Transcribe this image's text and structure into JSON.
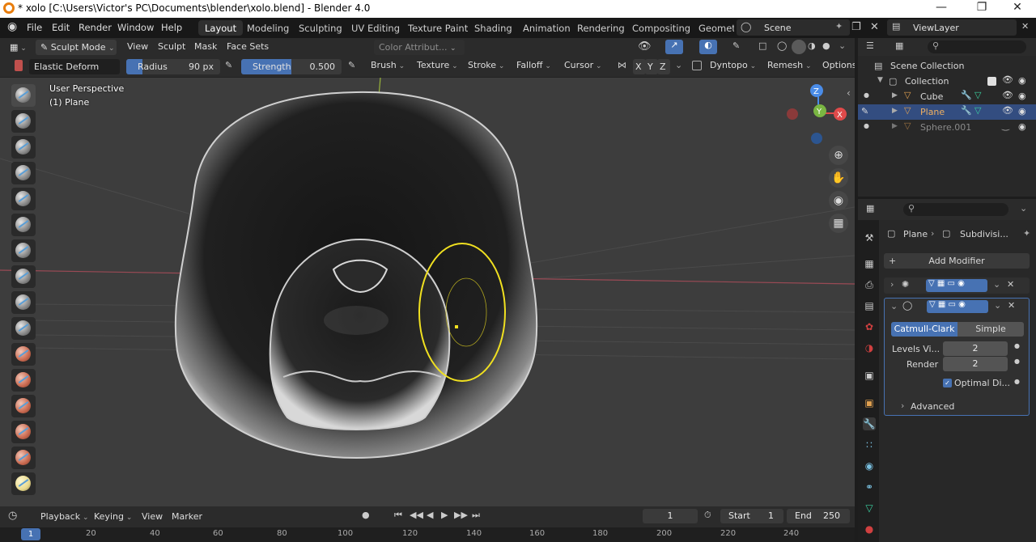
{
  "titlebar": {
    "title": "* xolo [C:\\Users\\Victor's PC\\Documents\\blender\\xolo.blend] - Blender 4.0",
    "minimize": "—",
    "maximize": "❐",
    "close": "✕"
  },
  "menu": [
    "File",
    "Edit",
    "Render",
    "Window",
    "Help"
  ],
  "workspaces": [
    "Layout",
    "Modeling",
    "Sculpting",
    "UV Editing",
    "Texture Paint",
    "Shading",
    "Animation",
    "Rendering",
    "Compositing",
    "Geomet"
  ],
  "scene": {
    "label": "Scene",
    "viewlayer": "ViewLayer"
  },
  "viewport_header": {
    "mode": "Sculpt Mode",
    "menus": [
      "View",
      "Sculpt",
      "Mask",
      "Face Sets"
    ],
    "color_attribute": "Color Attribut..."
  },
  "tool_settings": {
    "brush_name": "Elastic Deform",
    "radius_label": "Radius",
    "radius_value": "90 px",
    "strength_label": "Strength",
    "strength_value": "0.500",
    "dropdowns": [
      "Brush",
      "Texture",
      "Stroke",
      "Falloff",
      "Cursor"
    ],
    "axes": [
      "X",
      "Y",
      "Z"
    ],
    "dyntopo": "Dyntopo",
    "remesh": "Remesh",
    "options": "Options"
  },
  "viewport": {
    "perspective": "User Perspective",
    "object": "(1) Plane",
    "gizmo": {
      "x": "X",
      "y": "Y",
      "z": "Z"
    }
  },
  "outliner": {
    "root": "Scene Collection",
    "collection": "Collection",
    "items": [
      {
        "name": "Cube",
        "selected": false,
        "hidden": false
      },
      {
        "name": "Plane",
        "selected": true,
        "hidden": false
      },
      {
        "name": "Sphere.001",
        "selected": false,
        "hidden": true
      }
    ]
  },
  "properties": {
    "breadcrumb_object": "Plane",
    "breadcrumb_modifier": "Subdivisi...",
    "add_modifier": "Add Modifier",
    "subdiv": {
      "catmull": "Catmull-Clark",
      "simple": "Simple",
      "levels_label": "Levels Vi...",
      "levels_value": "2",
      "render_label": "Render",
      "render_value": "2",
      "optimal": "Optimal Di...",
      "advanced": "Advanced"
    }
  },
  "timeline": {
    "menus": [
      "Playback",
      "Keying",
      "View",
      "Marker"
    ],
    "current_frame": "1",
    "start_label": "Start",
    "start_value": "1",
    "end_label": "End",
    "end_value": "250",
    "ruler": [
      "1",
      "20",
      "40",
      "60",
      "80",
      "100",
      "120",
      "140",
      "160",
      "180",
      "200",
      "220",
      "240"
    ]
  },
  "colors": {
    "accent": "#4772b3",
    "brush_circle": "#f0e020",
    "selected_row": "#334d80"
  }
}
